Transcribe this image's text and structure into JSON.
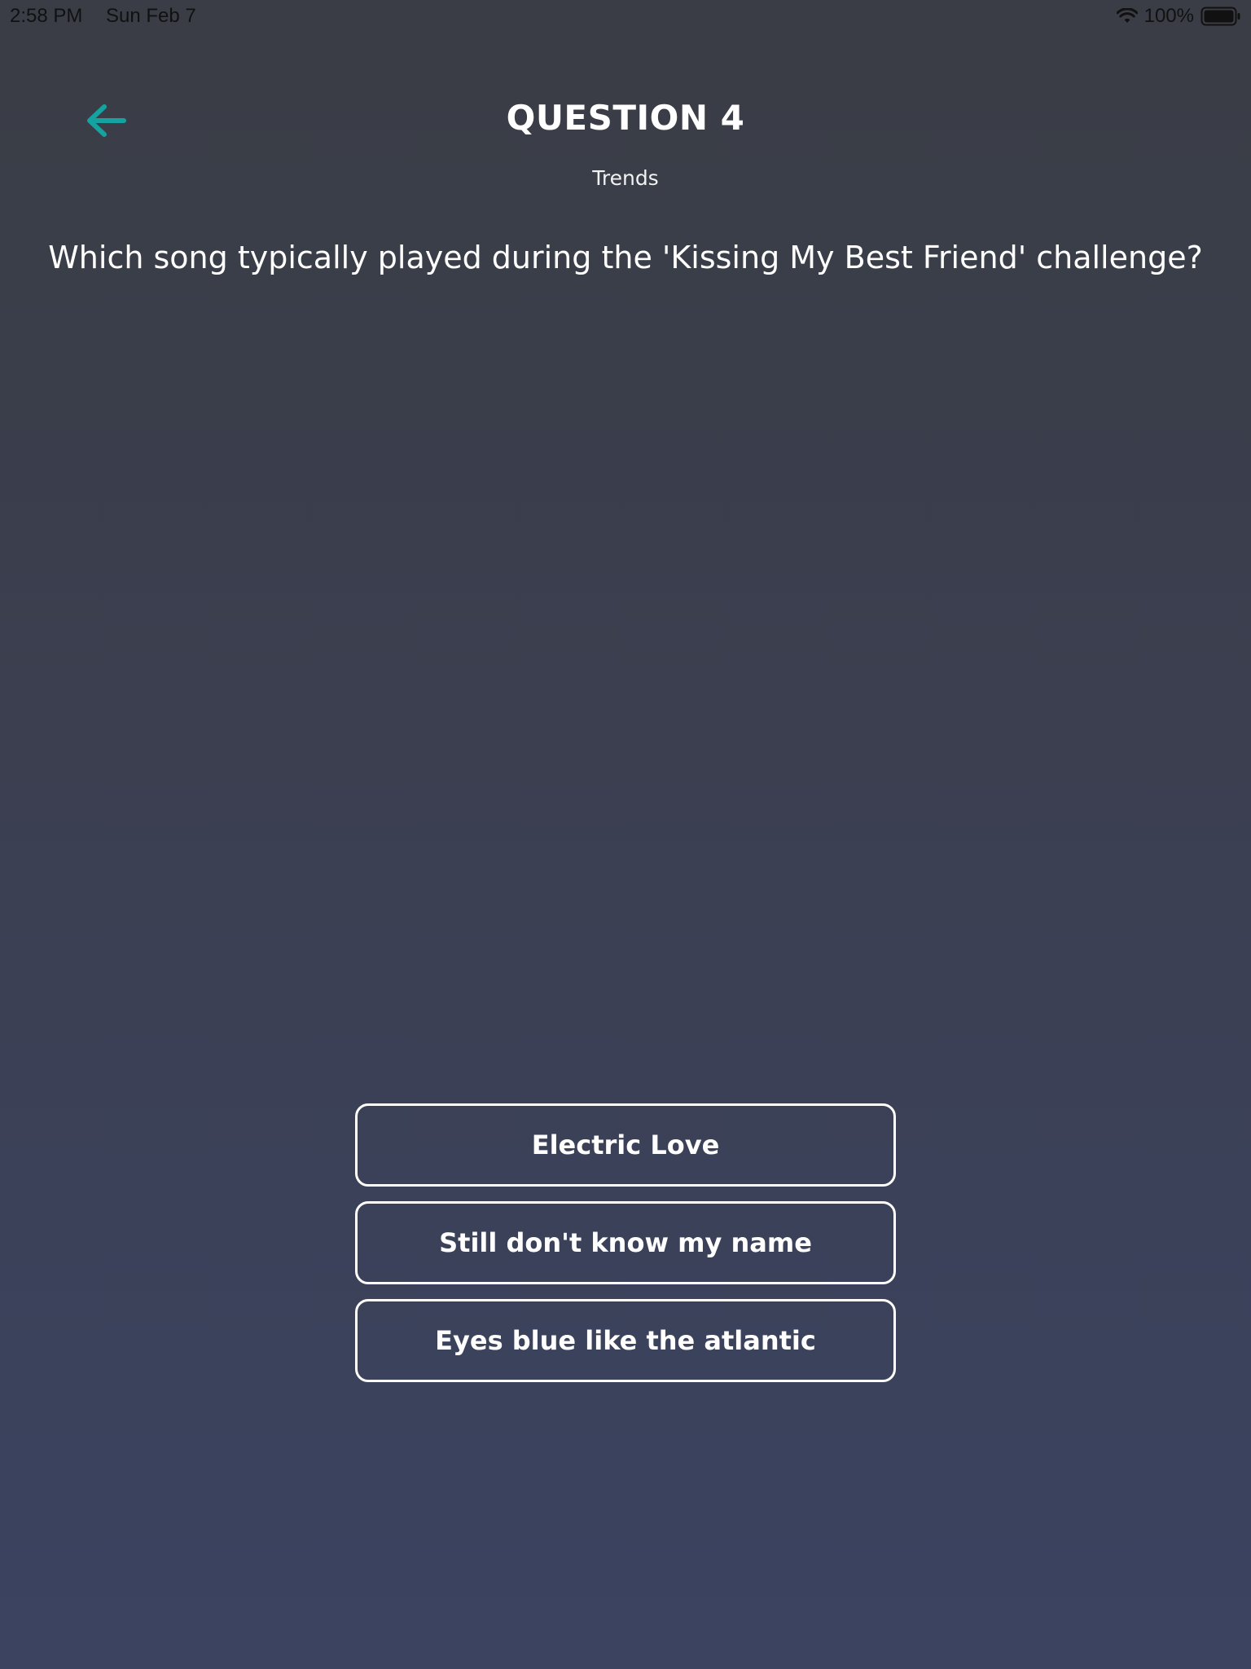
{
  "status_bar": {
    "time": "2:58 PM",
    "date": "Sun Feb 7",
    "battery": "100%",
    "icons": [
      "wifi-icon",
      "battery-icon"
    ]
  },
  "header": {
    "back_icon": "arrow-left-icon",
    "title": "QUESTION 4",
    "category": "Trends"
  },
  "question": {
    "text": "Which song typically played during the 'Kissing My Best Friend' challenge?"
  },
  "answers": [
    {
      "label": "Electric Love"
    },
    {
      "label": "Still don't know my name"
    },
    {
      "label": "Eyes blue like the atlantic"
    }
  ],
  "colors": {
    "accent": "#14a3a0",
    "background_top": "#3a3d45",
    "background_bottom": "#3b4361",
    "text": "#ffffff"
  }
}
